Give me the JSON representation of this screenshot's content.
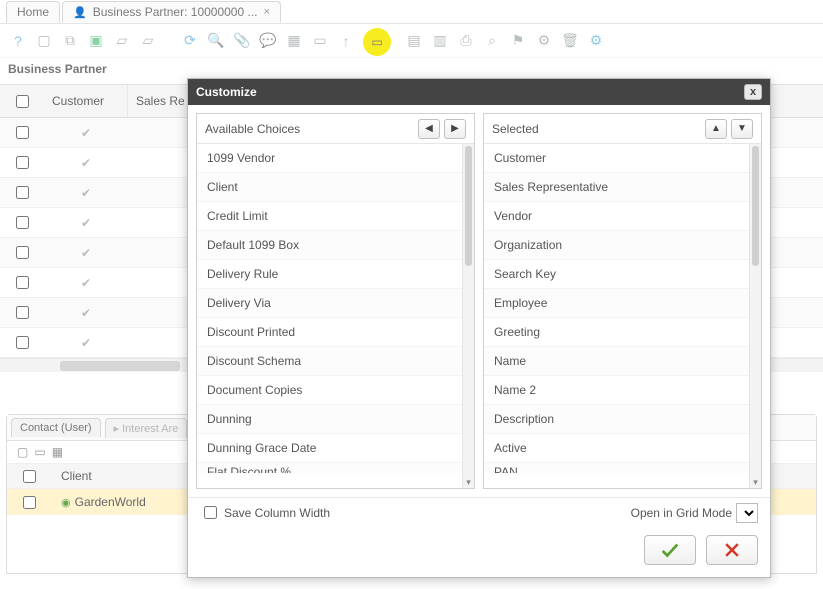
{
  "tabs": {
    "home": "Home",
    "bp": "Business Partner: 10000000 ...",
    "close_x": "×"
  },
  "breadcrumb": "Business Partner",
  "toolbar_icons": {
    "help": "help-circle-icon",
    "new": "new-doc-icon",
    "copy": "copy-icon",
    "save": "save-icon",
    "undo": "undo-box-icon",
    "refresh": "refresh-icon",
    "search": "search-icon",
    "attach": "attachment-icon",
    "chat": "chat-icon",
    "grid": "grid-icon",
    "form": "form-icon",
    "first": "nav-first-icon",
    "prev": "nav-prev-icon",
    "next": "nav-next-icon",
    "report": "report-icon",
    "archive": "archive-icon",
    "print": "print-icon",
    "zoom": "zoom-across-icon",
    "requests": "requests-icon",
    "process": "process-icon",
    "trash": "trash-icon",
    "gear": "gear-icon"
  },
  "bg_grid": {
    "headers": [
      "Customer",
      "Sales Re"
    ],
    "rows": 8
  },
  "subtabs": {
    "tab1": "Contact (User)",
    "tab2": "Interest Are",
    "header_col": "Client",
    "row_val": "GardenWorld"
  },
  "dialog": {
    "title": "Customize",
    "close": "x",
    "available_label": "Available Choices",
    "selected_label": "Selected",
    "move_right": "▶",
    "move_left": "◀",
    "move_up": "▲",
    "move_down": "▼",
    "available_items": [
      "1099 Vendor",
      "Client",
      "Credit Limit",
      "Default 1099 Box",
      "Delivery Rule",
      "Delivery Via",
      "Discount Printed",
      "Discount Schema",
      "Document Copies",
      "Dunning",
      "Dunning Grace Date",
      "Flat Discount %"
    ],
    "selected_items": [
      "Customer",
      "Sales Representative",
      "Vendor",
      "Organization",
      "Search Key",
      "Employee",
      "Greeting",
      "Name",
      "Name 2",
      "Description",
      "Active",
      "PAN"
    ],
    "save_col_width": "Save Column Width",
    "open_grid_mode": "Open in Grid Mode",
    "grid_mode_value": ""
  }
}
